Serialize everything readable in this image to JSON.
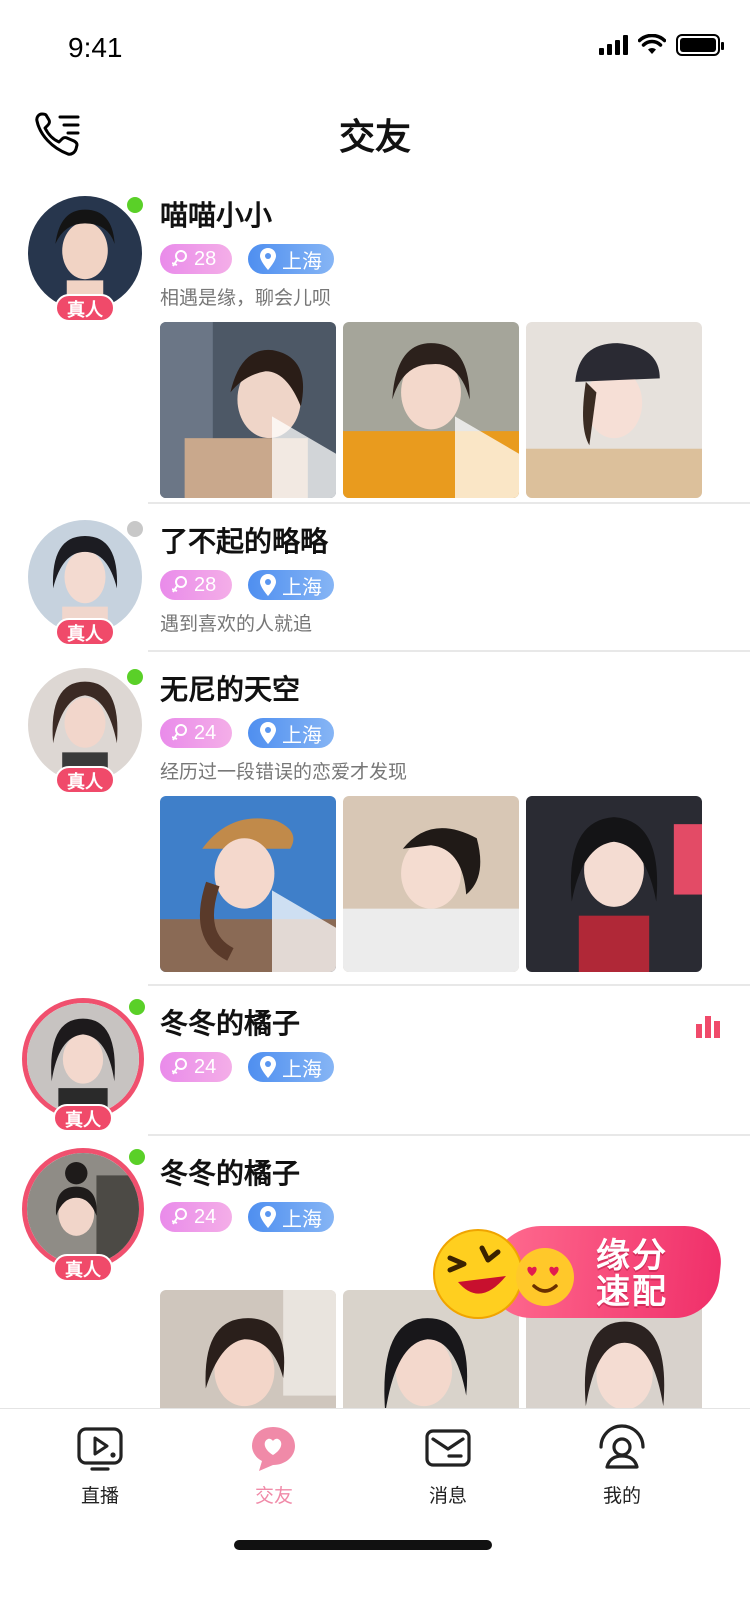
{
  "status_bar": {
    "time": "9:41"
  },
  "header": {
    "title": "交友"
  },
  "feed": [
    {
      "name": "喵喵小小",
      "age": "28",
      "city": "上海",
      "bio": "相遇是缘，聊会儿呗",
      "badge": "真人",
      "online": true,
      "photos": 3,
      "video_first": true
    },
    {
      "name": "了不起的略略",
      "age": "28",
      "city": "上海",
      "bio": "遇到喜欢的人就追",
      "badge": "真人",
      "online": false,
      "photos": 0
    },
    {
      "name": "无尼的天空",
      "age": "24",
      "city": "上海",
      "bio": "经历过一段错误的恋爱才发现",
      "badge": "真人",
      "online": true,
      "photos": 3,
      "video_first": true
    },
    {
      "name": "冬冬的橘子",
      "age": "24",
      "city": "上海",
      "bio": "",
      "badge": "真人",
      "online": true,
      "photos": 0,
      "ring": true
    },
    {
      "name": "冬冬的橘子",
      "age": "24",
      "city": "上海",
      "bio": "",
      "badge": "真人",
      "online": true,
      "photos": 3,
      "ring": true
    }
  ],
  "match": {
    "line1": "缘分",
    "line2": "速配"
  },
  "tabs": [
    {
      "label": "直播",
      "icon": "live-tv-icon"
    },
    {
      "label": "交友",
      "icon": "chat-heart-icon",
      "active": true
    },
    {
      "label": "消息",
      "icon": "mail-icon"
    },
    {
      "label": "我的",
      "icon": "profile-icon"
    }
  ],
  "colors": {
    "accent": "#f04a6a",
    "online": "#5ad028",
    "offline": "#c8c8c8",
    "tab_active": "#f08aa8",
    "tag_age": "#e98bea",
    "tag_city": "#4f8ff0"
  }
}
